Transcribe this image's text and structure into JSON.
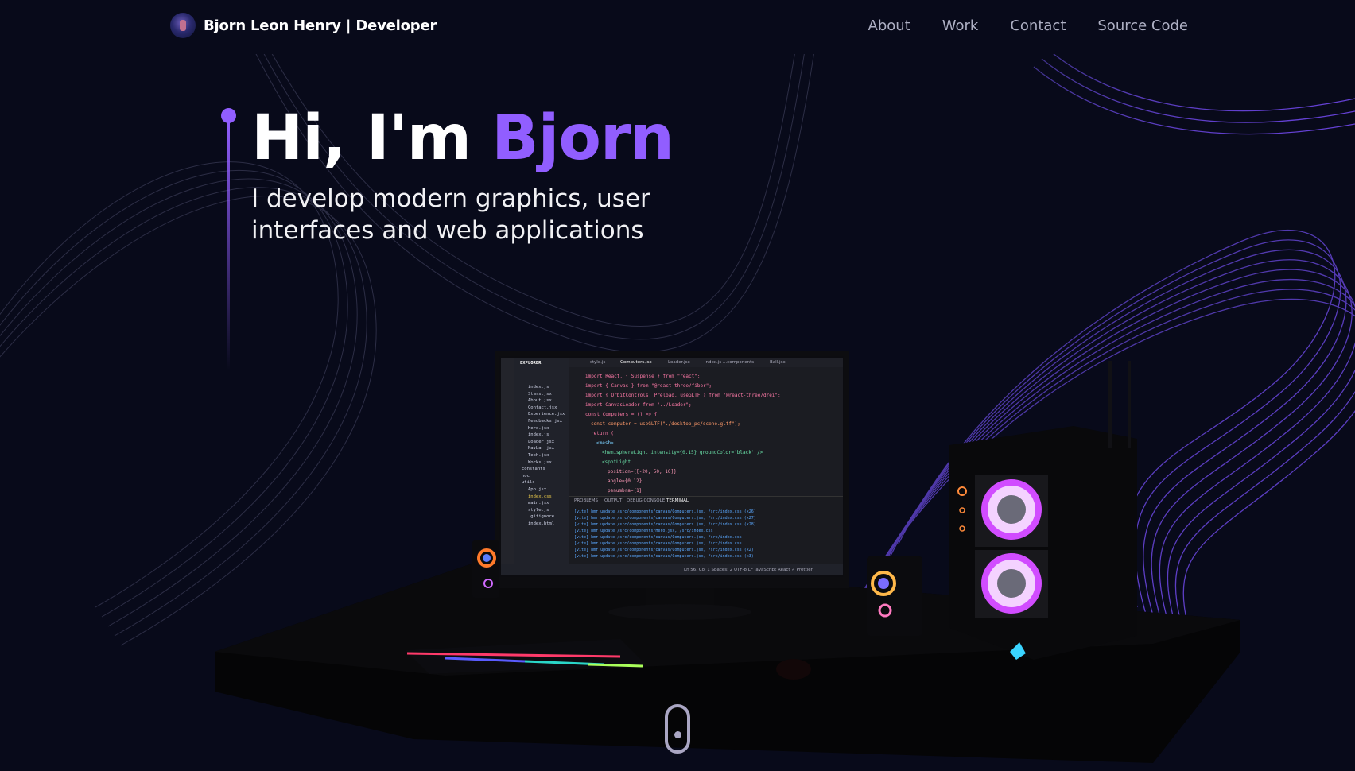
{
  "nav": {
    "brand": "Bjorn Leon Henry  | Developer",
    "links": [
      {
        "label": "About"
      },
      {
        "label": "Work"
      },
      {
        "label": "Contact"
      },
      {
        "label": "Source Code"
      }
    ]
  },
  "hero": {
    "greeting": "Hi, I'm ",
    "name": "Bjorn",
    "subtitle": "I develop modern graphics, user interfaces and web applications"
  },
  "screen": {
    "tabs": [
      "style.js",
      "Computers.jsx",
      "Loader.jsx",
      "index.js ...components",
      "Ball.jsx"
    ],
    "files": [
      "index.js",
      "Stars.jsx",
      "About.jsx",
      "Contact.jsx",
      "Experience.jsx",
      "Feedbacks.jsx",
      "Hero.jsx",
      "index.js",
      "Loader.jsx",
      "Navbar.jsx",
      "Tech.jsx",
      "Works.jsx",
      "constants",
      "hoc",
      "utils",
      "App.jsx",
      "index.css",
      "main.jsx",
      "style.js",
      ".gitignore",
      "index.html"
    ],
    "code": [
      "import React, { Suspense } from \"react\";",
      "import { Canvas } from \"@react-three/fiber\";",
      "import { OrbitControls, Preload, useGLTF } from \"@react-three/drei\";",
      "import CanvasLoader from \"../Loader\";",
      "const Computers = () => {",
      "  const computer = useGLTF(\"./desktop_pc/scene.gltf\");",
      "  return (",
      "    <mesh>",
      "      <hemisphereLight intensity={0.15} groundColor='black' />",
      "      <spotLight",
      "        position={[-20, 50, 10]}",
      "        angle={0.12}",
      "        penumbra={1}"
    ],
    "terminal_tabs": [
      "PROBLEMS",
      "OUTPUT",
      "DEBUG CONSOLE",
      "TERMINAL"
    ],
    "terminal": [
      "[vite] hmr update /src/components/canvas/Computers.jsx, /src/index.css (x26)",
      "[vite] hmr update /src/components/canvas/Computers.jsx, /src/index.css (x27)",
      "[vite] hmr update /src/components/canvas/Computers.jsx, /src/index.css (x28)",
      "[vite] hmr update /src/components/Hero.jsx, /src/index.css",
      "[vite] hmr update /src/components/canvas/Computers.jsx, /src/index.css",
      "[vite] hmr update /src/components/canvas/Computers.jsx, /src/index.css",
      "[vite] hmr update /src/components/canvas/Computers.jsx, /src/index.css (x2)",
      "[vite] hmr update /src/components/canvas/Computers.jsx, /src/index.css (x3)"
    ],
    "status": "Ln 56, Col 1   Spaces: 2   UTF-8   LF   JavaScript React   ✓ Prettier"
  },
  "colors": {
    "accent": "#915eff",
    "background": "#080a1a",
    "nav_link": "#aeb0c4"
  }
}
